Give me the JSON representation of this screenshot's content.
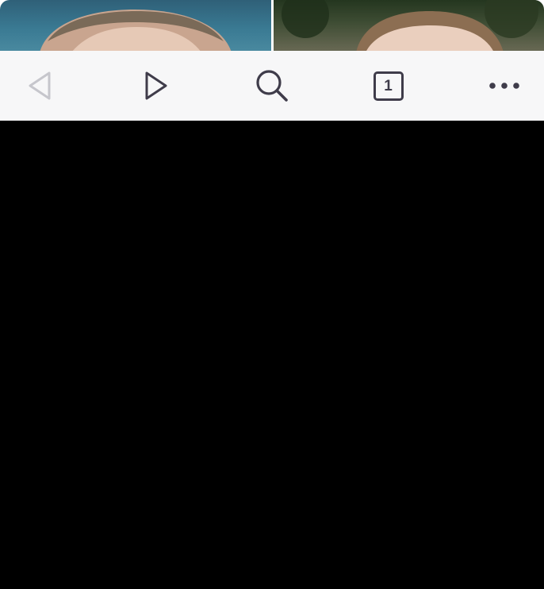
{
  "photos": {
    "left": {
      "kind": "photo"
    },
    "right": {
      "kind": "photo"
    }
  },
  "toolbar": {
    "back_icon": "back-triangle-icon",
    "forward_icon": "forward-triangle-icon",
    "search_icon": "search-icon",
    "tabs_count": "1",
    "more_icon": "more-dots-icon",
    "colors": {
      "background": "#f7f7f8",
      "icon_active": "#3f3c4a",
      "icon_disabled": "#c6c6cc"
    }
  }
}
